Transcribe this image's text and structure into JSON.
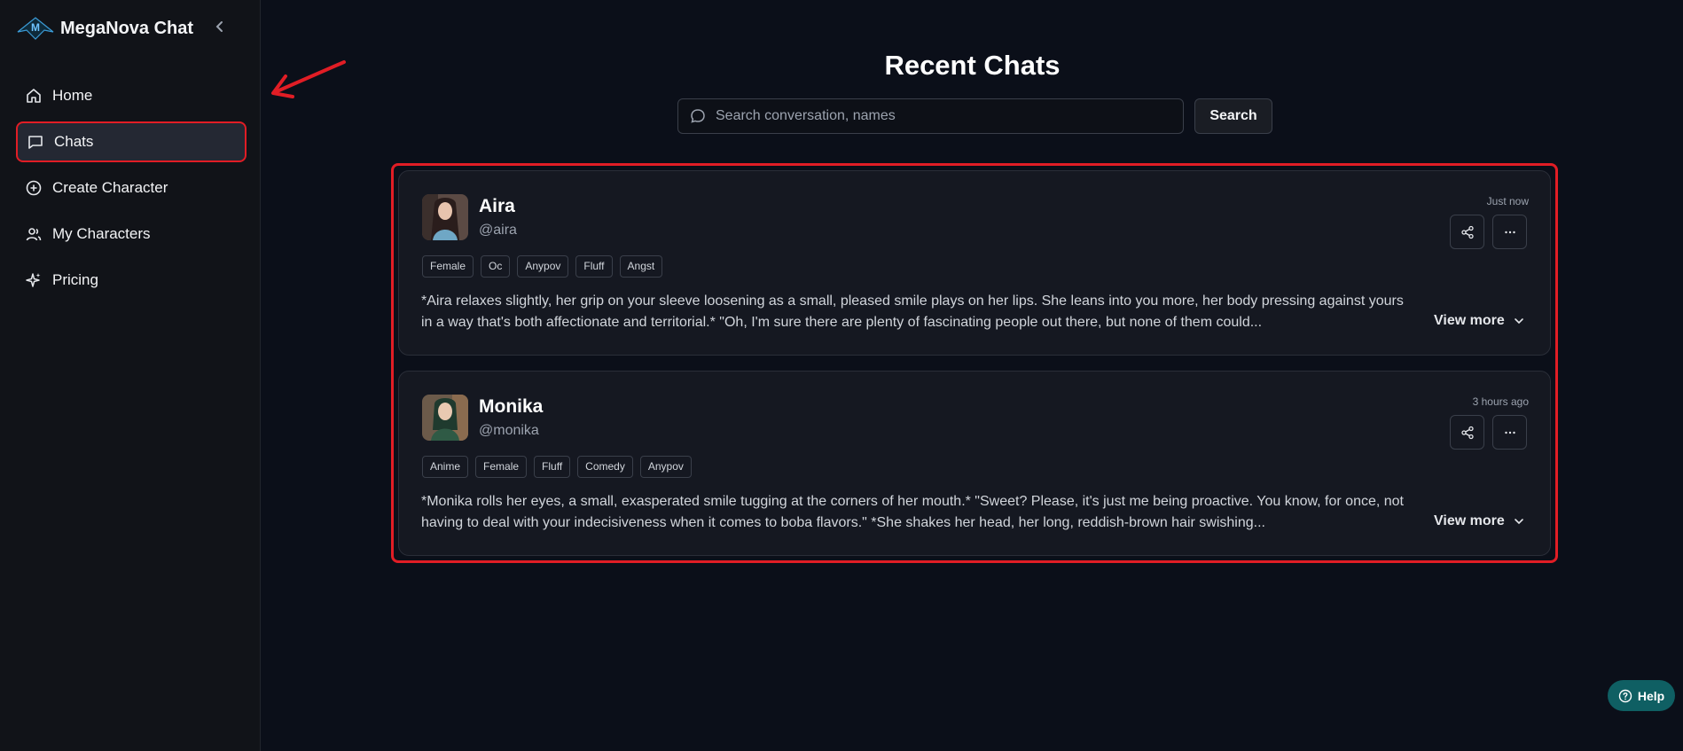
{
  "brand": {
    "name": "MegaNova Chat"
  },
  "sidebar": {
    "items": [
      {
        "label": "Home",
        "icon": "home-icon"
      },
      {
        "label": "Chats",
        "icon": "chat-icon",
        "active": true
      },
      {
        "label": "Create Character",
        "icon": "plus-circle-icon"
      },
      {
        "label": "My Characters",
        "icon": "users-icon"
      },
      {
        "label": "Pricing",
        "icon": "sparkles-icon"
      }
    ]
  },
  "main": {
    "title": "Recent Chats",
    "search": {
      "placeholder": "Search conversation, names",
      "value": "",
      "button_label": "Search"
    }
  },
  "chats": [
    {
      "name": "Aira",
      "handle": "@aira",
      "time": "Just now",
      "tags": [
        "Female",
        "Oc",
        "Anypov",
        "Fluff",
        "Angst"
      ],
      "message": "*Aira relaxes slightly, her grip on your sleeve loosening as a small, pleased smile plays on her lips. She leans into you more, her body pressing against yours in a way that's both affectionate and territorial.* \"Oh, I'm sure there are plenty of fascinating people out there, but none of them could...",
      "view_more": "View more"
    },
    {
      "name": "Monika",
      "handle": "@monika",
      "time": "3 hours ago",
      "tags": [
        "Anime",
        "Female",
        "Fluff",
        "Comedy",
        "Anypov"
      ],
      "message": "*Monika rolls her eyes, a small, exasperated smile tugging at the corners of her mouth.* \"Sweet? Please, it's just me being proactive. You know, for once, not having to deal with your indecisiveness when it comes to boba flavors.\" *She shakes her head, her long, reddish-brown hair swishing...",
      "view_more": "View more"
    }
  ],
  "help": {
    "label": "Help"
  },
  "colors": {
    "highlight": "#e11d25",
    "help_bg": "#0f5f63",
    "bg": "#0b0f19"
  }
}
